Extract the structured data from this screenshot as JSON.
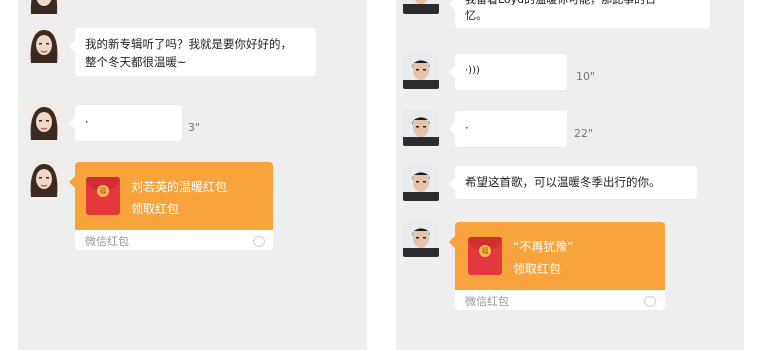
{
  "left_chat": {
    "top_cut_text": "",
    "msg1": {
      "line1": "我的新专辑听了吗？我就是要你好好的，",
      "line2": "整个冬天都很温暖~"
    },
    "voice1": {
      "glyph": "·",
      "duration": "3\""
    },
    "red_packet": {
      "title": "刘若英的温暖红包",
      "subtitle": "领取红包",
      "footer": "微信红包"
    }
  },
  "right_chat": {
    "top_bubble": {
      "line1": "我留着Loyd的温暖你可能，那此事的日",
      "line2": "忆。"
    },
    "voice1": {
      "glyph": "·)))",
      "duration": "10\""
    },
    "voice2": {
      "glyph": "·",
      "duration": "22\""
    },
    "msg": "希望这首歌，可以温暖冬季出行的你。",
    "red_packet": {
      "title": "“不再犹豫”",
      "subtitle": "领取红包",
      "footer": "微信红包"
    }
  },
  "colors": {
    "chat_bg": "#eeeeee",
    "bubble_bg": "#ffffff",
    "red_packet_orange": "#f9a33c",
    "envelope_red": "#e4393c"
  },
  "icons": {
    "female_avatar": "female-avatar",
    "male_avatar": "male-avatar",
    "envelope": "red-envelope-icon",
    "voice": "voice-wave-icon",
    "wechat_logo": "wechat-pay-logo"
  }
}
